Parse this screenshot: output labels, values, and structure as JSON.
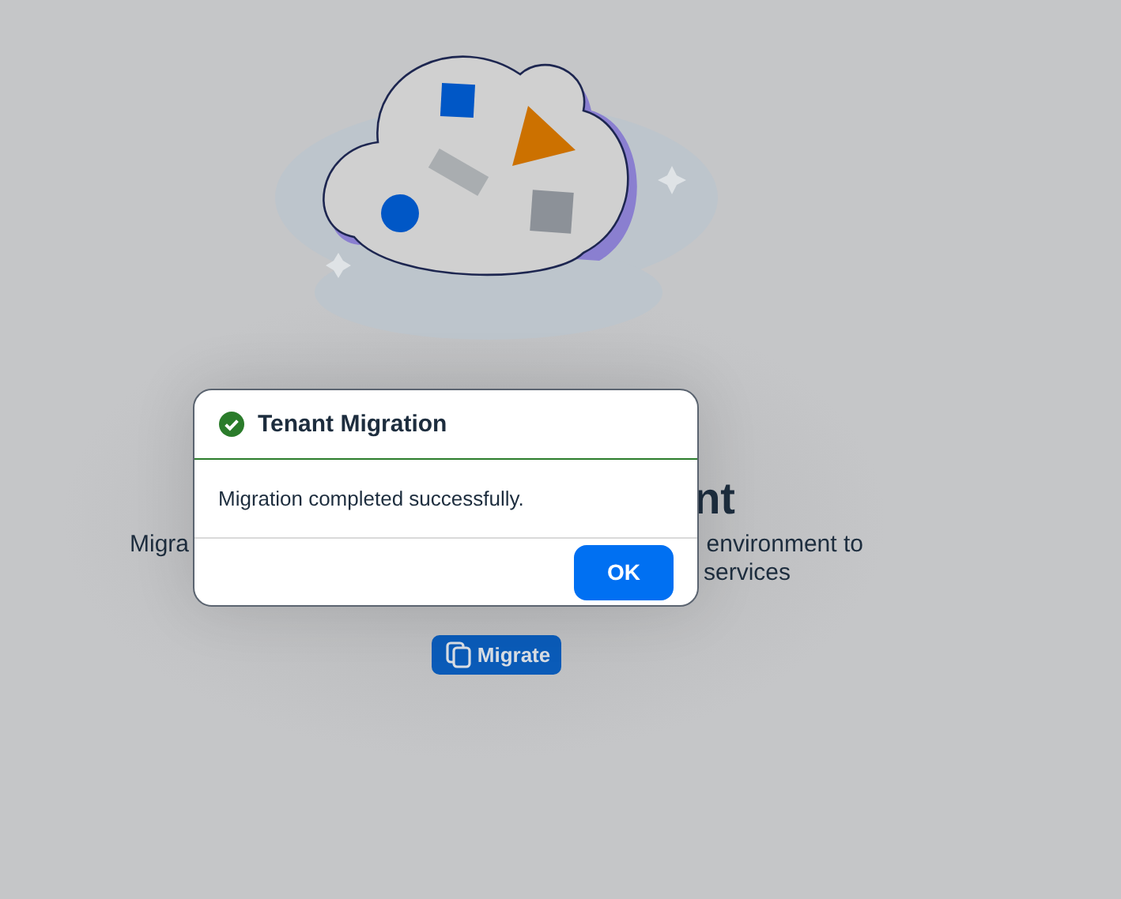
{
  "page": {
    "heading_visible": "nt",
    "description": {
      "line_1_start": "Migra",
      "line_1_end": "environment to",
      "line_2_end": "services"
    },
    "action": {
      "label": "Migrate"
    }
  },
  "dialog": {
    "title": "Tenant Migration",
    "kind": "success",
    "message": "Migration completed successfully.",
    "buttons": [
      {
        "label": "OK",
        "kind": "emphasized"
      }
    ]
  }
}
